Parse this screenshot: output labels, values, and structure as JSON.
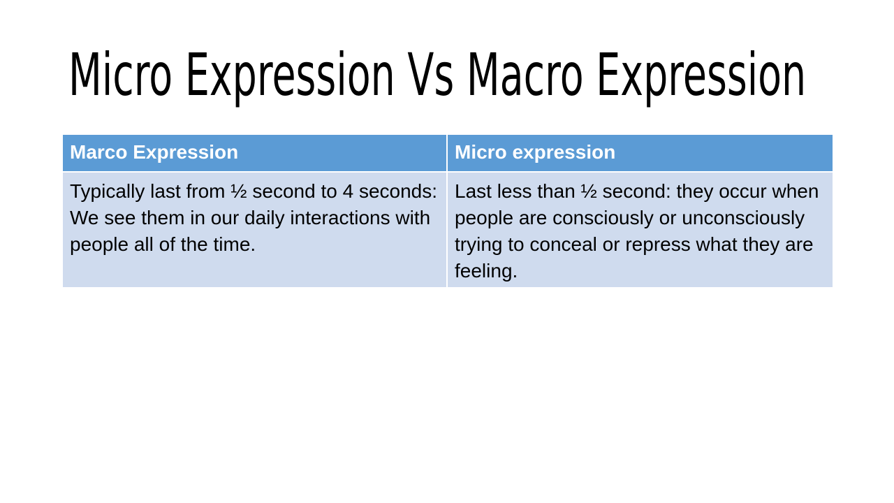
{
  "slide": {
    "title": "Micro Expression Vs Macro Expression"
  },
  "table": {
    "headers": [
      "Marco Expression",
      "Micro expression"
    ],
    "rows": [
      [
        "Typically last from ½ second to 4 seconds: We see them in our daily interactions with people all of the time.",
        "Last less than ½ second: they occur when people are consciously or unconsciously trying to conceal or repress what they are feeling."
      ]
    ]
  },
  "colors": {
    "header_bg": "#5b9bd5",
    "cell_bg": "#cfdbee",
    "title_text": "#000000"
  }
}
